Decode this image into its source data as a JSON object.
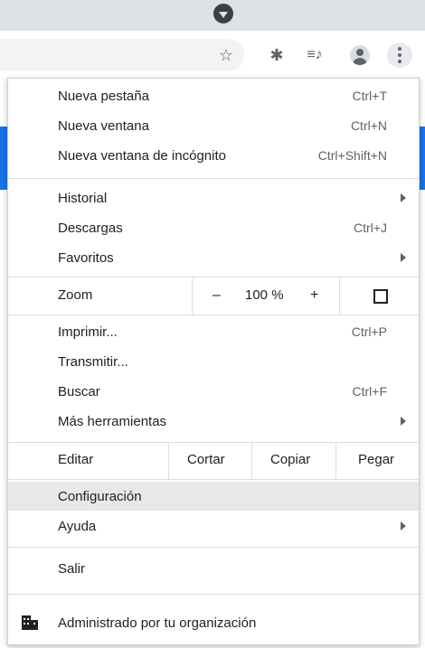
{
  "menu": {
    "items_top": [
      {
        "label": "Nueva pestaña",
        "shortcut": "Ctrl+T"
      },
      {
        "label": "Nueva ventana",
        "shortcut": "Ctrl+N"
      },
      {
        "label": "Nueva ventana de incógnito",
        "shortcut": "Ctrl+Shift+N"
      }
    ],
    "items_history": [
      {
        "label": "Historial"
      },
      {
        "label": "Descargas",
        "shortcut": "Ctrl+J"
      },
      {
        "label": "Favoritos"
      }
    ],
    "zoom": {
      "label": "Zoom",
      "minus": "–",
      "value": "100 %",
      "plus": "+"
    },
    "items_tools": [
      {
        "label": "Imprimir...",
        "shortcut": "Ctrl+P"
      },
      {
        "label": "Transmitir..."
      },
      {
        "label": "Buscar",
        "shortcut": "Ctrl+F"
      },
      {
        "label": "Más herramientas"
      }
    ],
    "edit": {
      "label": "Editar",
      "cut": "Cortar",
      "copy": "Copiar",
      "paste": "Pegar"
    },
    "items_settings": [
      {
        "label": "Configuración"
      },
      {
        "label": "Ayuda"
      }
    ],
    "exit": {
      "label": "Salir"
    },
    "managed": {
      "label": "Administrado por tu organización"
    }
  },
  "toolbar": {
    "star": "☆",
    "extensions": "✱",
    "media": "≡♪"
  },
  "colors": {
    "highlight": "#e8e8e8",
    "accent": "#1a73e8"
  }
}
